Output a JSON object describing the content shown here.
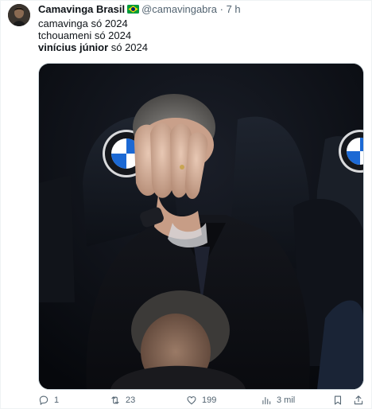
{
  "post": {
    "author_name": "Camavinga Brasil",
    "author_flag_icon": "brazil-flag-icon",
    "handle": "@camavingabra",
    "separator": "·",
    "time": "7 h",
    "lines": [
      {
        "lead": "camavinga",
        "rest": " só 2024"
      },
      {
        "lead": "tchouameni",
        "rest": " só 2024"
      },
      {
        "lead": "vinícius júnior",
        "rest": " só 2024"
      }
    ]
  },
  "actions": {
    "reply_count": "1",
    "repost_count": "23",
    "like_count": "199",
    "views_count": "3 mil"
  },
  "colors": {
    "text": "#0f1419",
    "muted": "#536471",
    "border": "#cfd9de",
    "bmw_blue": "#1c69d4"
  }
}
